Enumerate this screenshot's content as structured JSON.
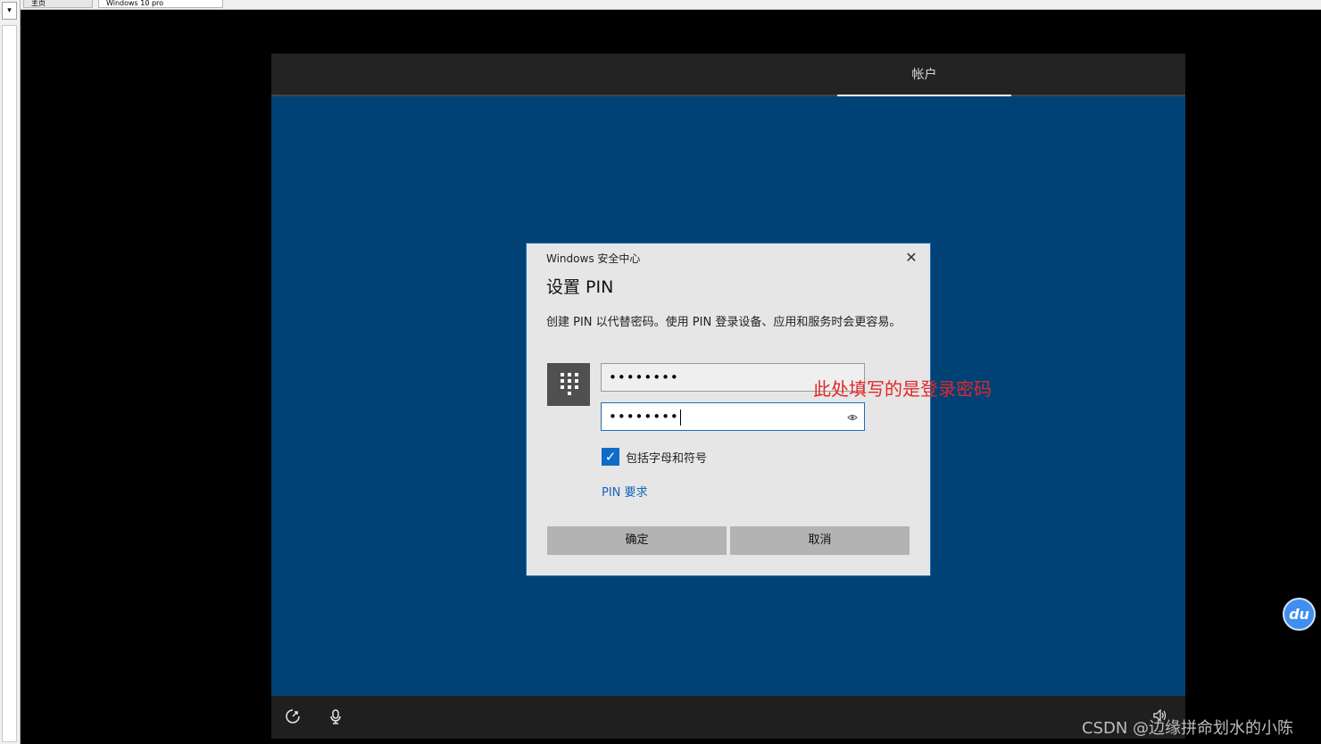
{
  "host": {
    "tabs": [
      "主页",
      "Windows 10 pro"
    ],
    "dropdown_glyph": "▾"
  },
  "vm": {
    "header": {
      "active_tab": "帐户"
    },
    "footer": {
      "ease_of_access_icon": "ease-of-access-icon",
      "microphone_icon": "microphone-icon",
      "volume_icon": "volume-icon"
    }
  },
  "dialog": {
    "app_title": "Windows 安全中心",
    "close_glyph": "✕",
    "heading": "设置 PIN",
    "description": "创建 PIN 以代替密码。使用 PIN 登录设备、应用和服务时会更容易。",
    "new_pin": {
      "value": "••••••••"
    },
    "confirm_pin": {
      "value": "••••••••",
      "reveal_glyph": "👁"
    },
    "include_letters": {
      "label": "包括字母和符号",
      "checked": true,
      "glyph": "✓"
    },
    "requirements_link": "PIN 要求",
    "ok_label": "确定",
    "cancel_label": "取消"
  },
  "overlay": {
    "annotation": "此处填写的是登录密码",
    "badge": "du",
    "watermark": "CSDN @边缘拼命划水的小陈"
  },
  "colors": {
    "vm_background": "#004275",
    "accent": "#0e6cc7",
    "annotation": "#e0282a"
  }
}
